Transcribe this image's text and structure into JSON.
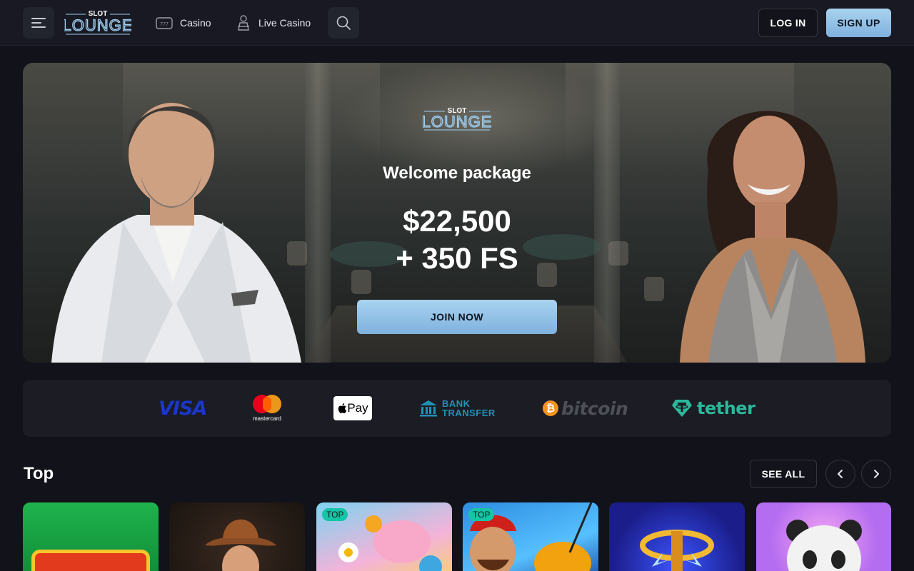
{
  "header": {
    "logo_small": "SLOT",
    "logo_big": "LOUNGE",
    "nav": [
      {
        "label": "Casino",
        "icon": "slot-machine-icon"
      },
      {
        "label": "Live Casino",
        "icon": "dealer-icon"
      }
    ],
    "login_label": "LOG IN",
    "signup_label": "SIGN UP"
  },
  "hero": {
    "logo_small": "SLOT",
    "logo_big": "LOUNGE",
    "title": "Welcome package",
    "amount": "$22,500",
    "free_spins": "+ 350 FS",
    "cta_label": "JOIN NOW"
  },
  "payments": {
    "visa": "VISA",
    "mastercard": "mastercard",
    "applepay": "Pay",
    "bank_line1": "BANK",
    "bank_line2": "TRANSFER",
    "bitcoin": "bitcoin",
    "tether": "tether"
  },
  "top": {
    "title": "Top",
    "see_all_label": "SEE ALL",
    "games": [
      {
        "name": "game-1",
        "tag": ""
      },
      {
        "name": "game-2",
        "tag": ""
      },
      {
        "name": "game-3",
        "tag": "TOP"
      },
      {
        "name": "game-4",
        "tag": "TOP"
      },
      {
        "name": "game-5",
        "tag": ""
      },
      {
        "name": "game-6",
        "tag": ""
      }
    ]
  },
  "colors": {
    "background": "#11121a",
    "header": "#181922",
    "accent_button": "#8fc0e6",
    "tag": "#17c4a6"
  }
}
